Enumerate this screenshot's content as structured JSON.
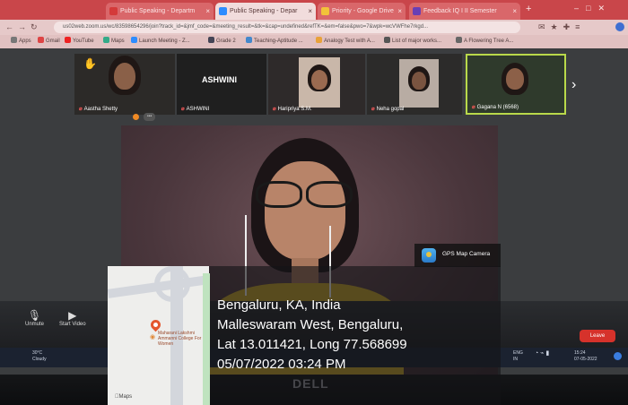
{
  "browser": {
    "tabs": [
      {
        "label": "Public Speaking - Departm"
      },
      {
        "label": "Public Speaking - Depar"
      },
      {
        "label": "Priority - Google Drive"
      },
      {
        "label": "Feedback IQ I II Semester"
      }
    ],
    "new_tab": "+",
    "url": "us02web.zoom.us/wc/83598654296/join?track_id=&jmf_code=&meeting_result=&tk=&cap=undefined&refTK=&em=false&pwo=7&wpk=wcVWFhe7rkgd...",
    "bookmarks": [
      "Apps",
      "Gmail",
      "YouTube",
      "Maps",
      "Launch Meeting - Z...",
      "Grade 2",
      "Teaching-Aptitude ...",
      "Analogy Test with A...",
      "List of major works...",
      "A Flowering Tree A..."
    ]
  },
  "zoom": {
    "participants": [
      {
        "name": "Aastha Shetty"
      },
      {
        "name": "ASHWINI",
        "big_name": "ASHWINI"
      },
      {
        "name": "Haripriya S.M."
      },
      {
        "name": "Neha gopal"
      },
      {
        "name": "Gagana N (6568)"
      }
    ],
    "toolbar": {
      "unmute": "Unmute",
      "start_video": "Start Video",
      "leave": "Leave"
    },
    "rec_badge": "•••"
  },
  "taskbar": {
    "weather_temp": "30°C",
    "weather_desc": "Cloudy",
    "lang": "ENG",
    "lang2": "IN",
    "time": "15:24",
    "date": "07-05-2022"
  },
  "gps": {
    "camera_label": "GPS Map Camera",
    "line1": "Bengaluru, KA, India",
    "line2": "Malleswaram West, Bengaluru,",
    "line3": "Lat 13.011421, Long 77.568699",
    "line4": "05/07/2022 03:24 PM",
    "map_place": "Maharani Lakshmi Ammanni College For Women",
    "maps_logo": "Maps"
  },
  "brand": "DÆLL",
  "colors": {
    "accent": "#c9464a",
    "leave": "#d6322b",
    "zoom_blue": "#2d8cff"
  }
}
